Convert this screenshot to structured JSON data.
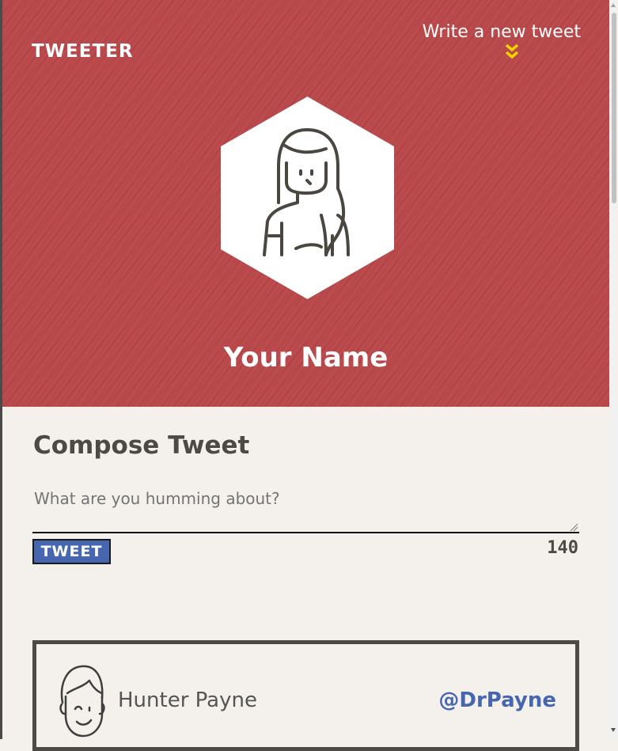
{
  "header": {
    "brand": "TWEETER",
    "write_new": "Write a new tweet",
    "profile_name": "Your Name"
  },
  "compose": {
    "title": "Compose Tweet",
    "placeholder": "What are you humming about?",
    "button_label": "TWEET",
    "char_count": "140"
  },
  "tweets": [
    {
      "author_name": "Hunter Payne",
      "handle": "@DrPayne"
    }
  ],
  "colors": {
    "header_red": "#b9484a",
    "accent_blue": "#4766b0",
    "chevron_yellow": "#f5d300",
    "page_bg": "#f4f1ec",
    "dark_text": "#4d4a45"
  },
  "icons": {
    "scroll_hint": "double-chevron-down-icon",
    "profile": "woman-avatar-icon",
    "tweet_author": "man-avatar-icon"
  }
}
